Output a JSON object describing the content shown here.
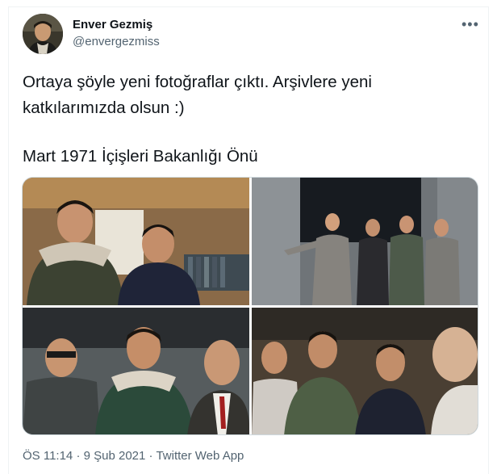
{
  "author": {
    "name": "Enver Gezmiş",
    "handle": "@envergezmiss"
  },
  "menu_icon": "more-horizontal-icon",
  "tweet": {
    "line1": "Ortaya şöyle yeni fotoğraflar çıktı. Arşivlere yeni",
    "line2": "katkılarımızda olsun :)",
    "line3": "Mart 1971 İçişleri Bakanlığı Önü"
  },
  "meta": {
    "time": "ÖS 11:14",
    "sep1": "·",
    "date": "9 Şub 2021",
    "sep2": "·",
    "source": "Twitter Web App"
  },
  "colors": {
    "text": "#0f1419",
    "secondary": "#536471",
    "border": "#cfd9de"
  }
}
